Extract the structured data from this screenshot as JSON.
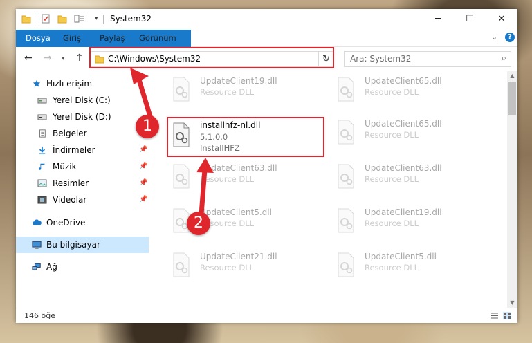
{
  "window": {
    "title": "System32"
  },
  "ribbon": {
    "tabs": [
      "Dosya",
      "Giriş",
      "Paylaş",
      "Görünüm"
    ]
  },
  "nav": {
    "address": "C:\\Windows\\System32",
    "search_placeholder": "Ara: System32"
  },
  "sidebar": {
    "items": [
      {
        "label": "Hızlı erişim",
        "icon": "star-icon"
      },
      {
        "label": "Yerel Disk (C:)",
        "icon": "drive-icon"
      },
      {
        "label": "Yerel Disk (D:)",
        "icon": "drive-icon"
      },
      {
        "label": "Belgeler",
        "icon": "documents-icon"
      },
      {
        "label": "İndirmeler",
        "icon": "download-icon"
      },
      {
        "label": "Müzik",
        "icon": "music-icon"
      },
      {
        "label": "Resimler",
        "icon": "pictures-icon"
      },
      {
        "label": "Videolar",
        "icon": "video-icon"
      },
      {
        "label": "OneDrive",
        "icon": "cloud-icon"
      },
      {
        "label": "Bu bilgisayar",
        "icon": "computer-icon"
      },
      {
        "label": "Ağ",
        "icon": "network-icon"
      }
    ]
  },
  "files": {
    "highlighted": {
      "name": "installhfz-nl.dll",
      "version": "5.1.0.0",
      "company": "InstallHFZ"
    },
    "left_column": [
      {
        "name": "UpdateClient19.dll",
        "type": "Resource DLL"
      },
      {
        "name": "UpdateClient63.dll",
        "type": "Resource DLL"
      },
      {
        "name": "UpdateClient5.dll",
        "type": "Resource DLL"
      },
      {
        "name": "UpdateClient21.dll",
        "type": "Resource DLL"
      }
    ],
    "right_column": [
      {
        "name": "UpdateClient65.dll",
        "type": "Resource DLL"
      },
      {
        "name": "UpdateClient65.dll",
        "type": "Resource DLL"
      },
      {
        "name": "UpdateClient63.dll",
        "type": "Resource DLL"
      },
      {
        "name": "UpdateClient19.dll",
        "type": "Resource DLL"
      },
      {
        "name": "UpdateClient5.dll",
        "type": "Resource DLL"
      }
    ]
  },
  "status": {
    "count": "146 öğe"
  },
  "annotations": {
    "badge1": "1",
    "badge2": "2"
  },
  "colors": {
    "accent": "#1979ca",
    "annotation": "#e0262d",
    "selection": "#cce8ff"
  }
}
